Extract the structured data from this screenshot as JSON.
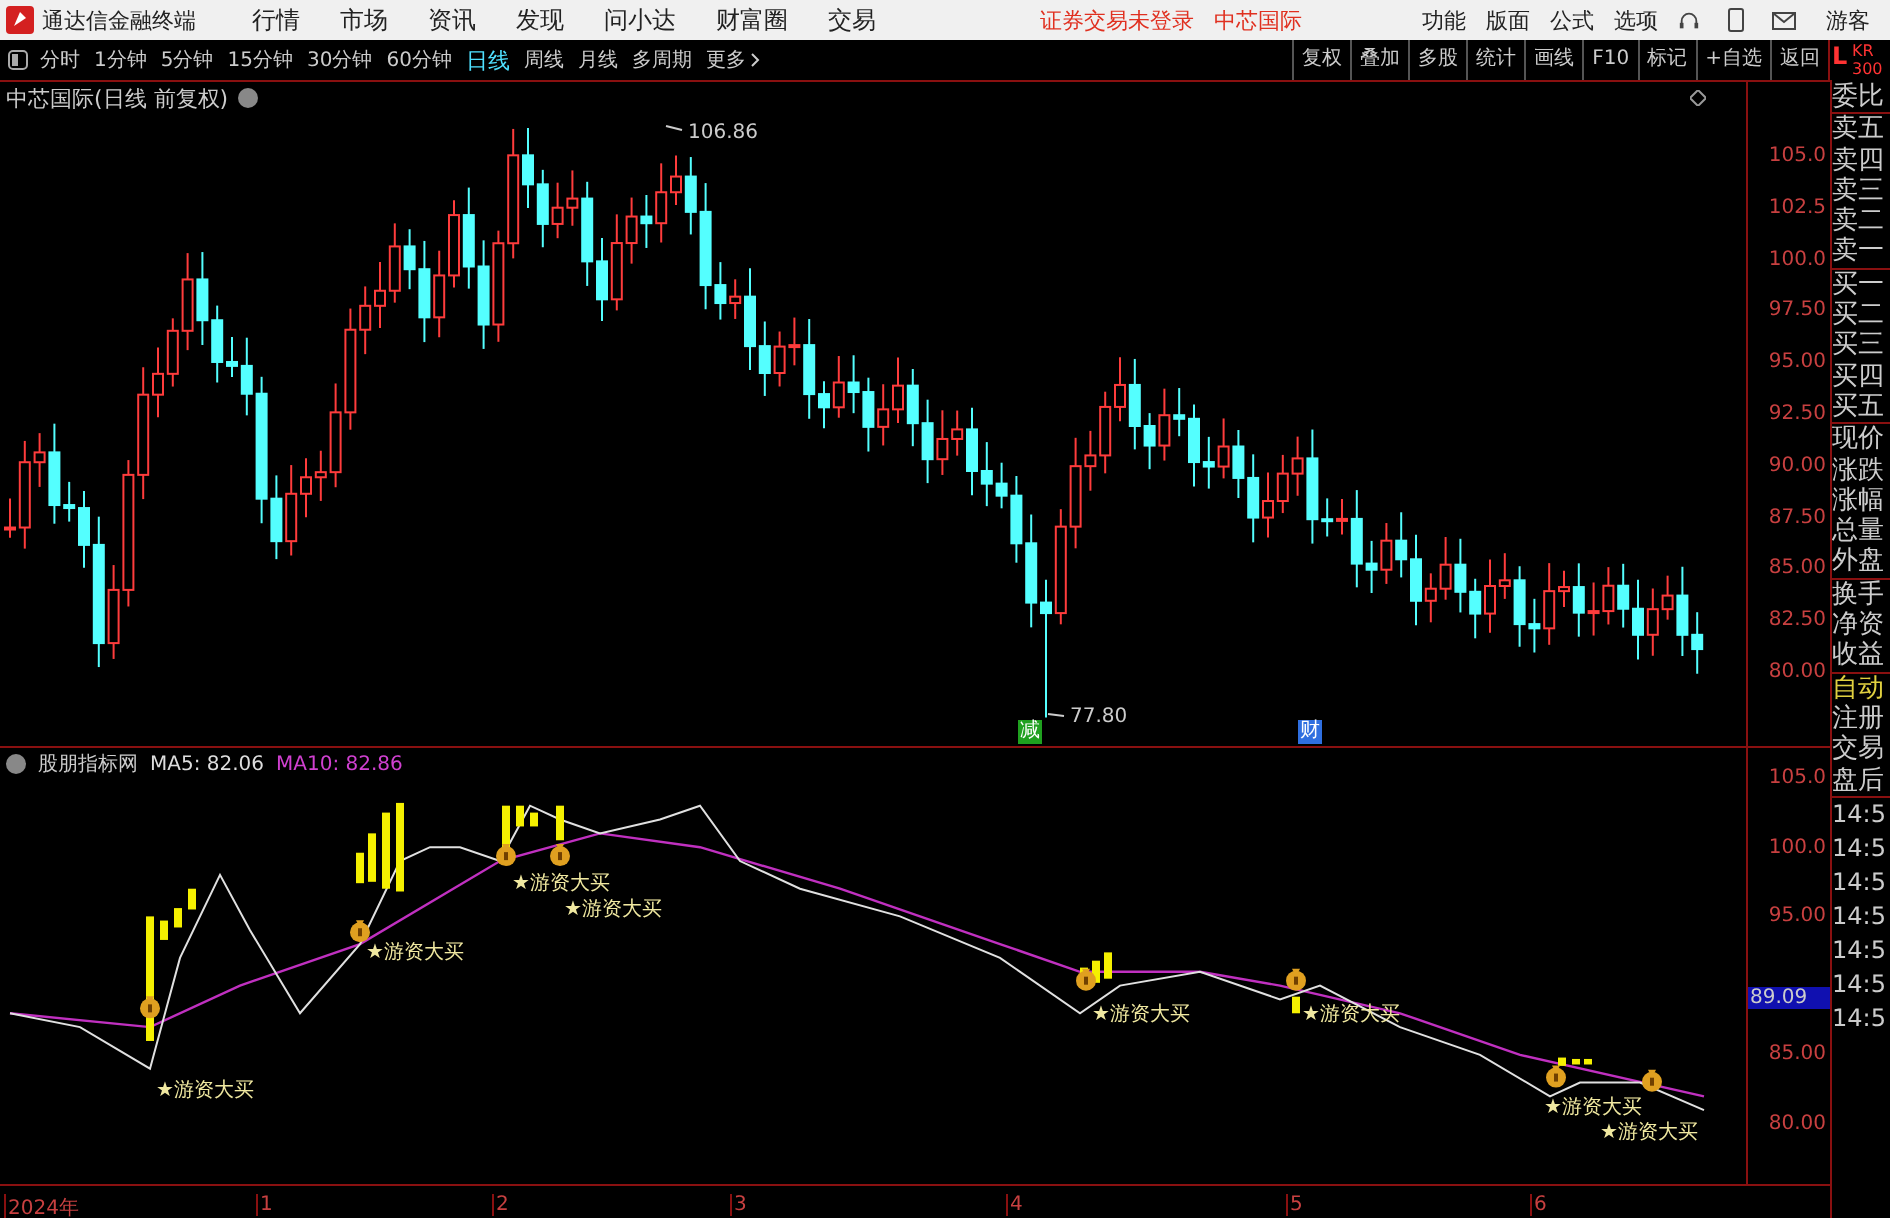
{
  "title_bar": {
    "app_name": "通达信金融终端",
    "menu": [
      "行情",
      "市场",
      "资讯",
      "发现",
      "问小达",
      "财富圈",
      "交易"
    ],
    "status": "证券交易未登录",
    "stock": "中芯国际",
    "right_menu": [
      "功能",
      "版面",
      "公式",
      "选项"
    ],
    "user": "游客"
  },
  "toolbar": {
    "periods": [
      {
        "label": "分时",
        "selected": false
      },
      {
        "label": "1分钟",
        "selected": false
      },
      {
        "label": "5分钟",
        "selected": false
      },
      {
        "label": "15分钟",
        "selected": false
      },
      {
        "label": "30分钟",
        "selected": false
      },
      {
        "label": "60分钟",
        "selected": false
      },
      {
        "label": "日线",
        "selected": true
      },
      {
        "label": "周线",
        "selected": false
      },
      {
        "label": "月线",
        "selected": false
      },
      {
        "label": "多周期",
        "selected": false
      }
    ],
    "more": "更多",
    "buttons": [
      "复权",
      "叠加",
      "多股",
      "统计",
      "画线",
      "F10",
      "标记",
      "+自选",
      "返回"
    ]
  },
  "side_header": {
    "letter": "L",
    "code": "KR",
    "sub": "300"
  },
  "main_chart": {
    "title": "中芯国际(日线 前复权)",
    "y_ticks": [
      "105.0",
      "102.5",
      "100.0",
      "97.50",
      "95.00",
      "92.50",
      "90.00",
      "87.50",
      "85.00",
      "82.50",
      "80.00"
    ],
    "high_label": "106.86",
    "low_label": "77.80",
    "event_marks": [
      {
        "text": "减",
        "color": "#1fa01f"
      },
      {
        "text": "财",
        "color": "#2f6fe0"
      }
    ]
  },
  "indicator": {
    "name": "股朋指标网",
    "ma5": "MA5: 82.06",
    "ma10": "MA10: 82.86",
    "y_ticks": [
      "105.0",
      "100.0",
      "95.00",
      "85.00",
      "80.00"
    ],
    "current_value": "89.09",
    "signals": [
      "★游资大买",
      "★游资大买",
      "★游资大买",
      "★游资大买",
      "★游资大买",
      "★游资大买",
      "★游资大买",
      "★游资大买"
    ]
  },
  "x_axis": [
    "2024年",
    "1",
    "2",
    "3",
    "4",
    "5",
    "6"
  ],
  "quote_panel": {
    "groups": [
      [
        "委比"
      ],
      [
        "卖五",
        "卖四",
        "卖三",
        "卖二",
        "卖一"
      ],
      [
        "买一",
        "买二",
        "买三",
        "买四",
        "买五"
      ],
      [
        "现价",
        "涨跌",
        "涨幅",
        "总量",
        "外盘"
      ],
      [
        "换手",
        "净资",
        "收益"
      ]
    ],
    "trade_items": [
      {
        "label": "自动",
        "highlighted": true
      },
      {
        "label": "注册",
        "highlighted": false
      },
      {
        "label": "交易",
        "highlighted": false
      },
      {
        "label": "盘后",
        "highlighted": false
      }
    ],
    "times": [
      "14:5",
      "14:5",
      "14:5",
      "14:5",
      "14:5",
      "14:5",
      "14:5"
    ]
  }
}
